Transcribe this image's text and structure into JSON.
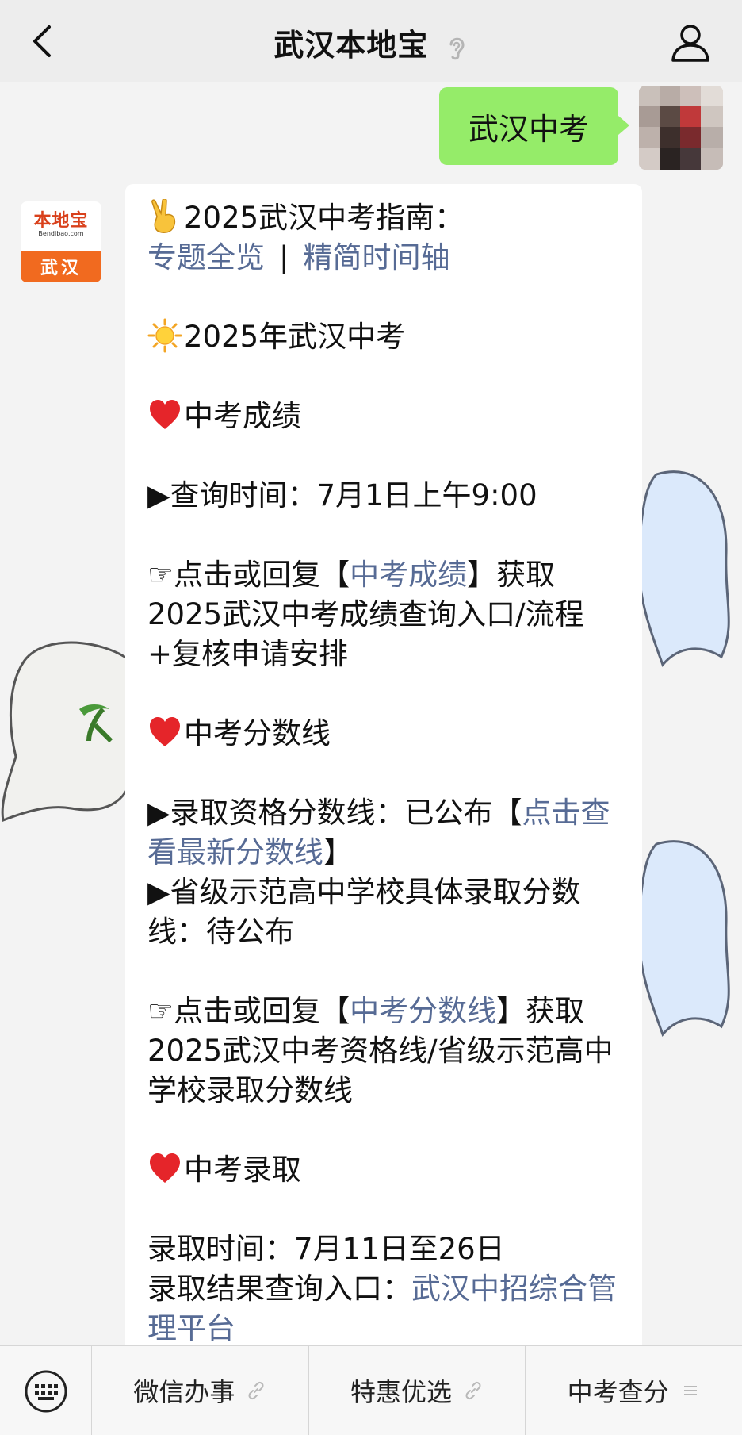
{
  "header": {
    "title": "武汉本地宝"
  },
  "user_message": {
    "text": "武汉中考"
  },
  "bot_avatar": {
    "brand": "本地宝",
    "domain": "Bendibao.com",
    "city": "武汉"
  },
  "article": {
    "guide_title": "2025武汉中考指南：",
    "link_overview": "专题全览",
    "separator": "|",
    "link_timeline": "精简时间轴",
    "exam_heading": "2025年武汉中考",
    "section_scores": {
      "heading": "中考成绩",
      "query_time": "▶查询时间：7月1日上午9:00",
      "tip_prefix": "☞点击或回复【",
      "tip_link": "中考成绩",
      "tip_suffix": "】获取2025武汉中考成绩查询入口/流程+复核申请安排"
    },
    "section_cutoff": {
      "heading": "中考分数线",
      "line1_prefix": "▶录取资格分数线：已公布【",
      "line1_link": "点击查看最新分数线",
      "line1_suffix": "】",
      "line2": "▶省级示范高中学校具体录取分数线：待公布",
      "tip_prefix": "☞点击或回复【",
      "tip_link": "中考分数线",
      "tip_suffix": "】获取2025武汉中考资格线/省级示范高中学校录取分数线"
    },
    "section_admission": {
      "heading": "中考录取",
      "time": "录取时间：7月11日至26日",
      "result_prefix": "录取结果查询入口：",
      "result_link": "武汉中招综合管理平台"
    }
  },
  "bottom_menu": {
    "items": [
      {
        "label": "微信办事",
        "icon": "link-icon"
      },
      {
        "label": "特惠优选",
        "icon": "link-icon"
      },
      {
        "label": "中考查分",
        "icon": "menu-lines-icon"
      }
    ]
  },
  "colors": {
    "link": "#576b95",
    "user_bubble": "#95ec69",
    "brand_orange": "#f16a1f"
  }
}
